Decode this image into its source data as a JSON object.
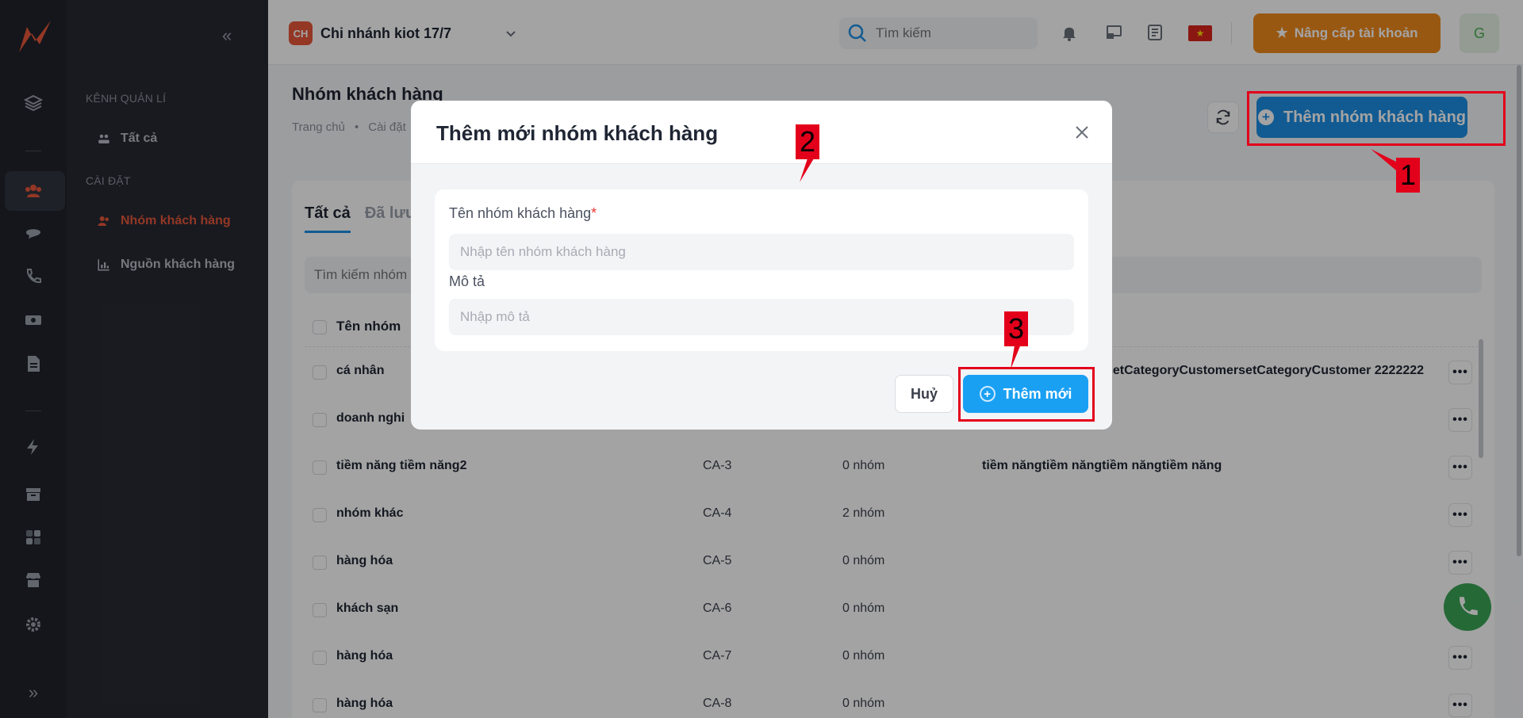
{
  "branch": {
    "badge": "CH",
    "name": "Chi nhánh kiot 17/7"
  },
  "search": {
    "placeholder": "Tìm kiếm"
  },
  "upgrade_label": "Nâng cấp tài khoản",
  "avatar_letter": "G",
  "sidebar": {
    "section_manage": "KÊNH QUẢN LÍ",
    "section_settings": "CÀI ĐẶT",
    "items": [
      {
        "label": "Tất cả"
      },
      {
        "label": "Nhóm khách hàng"
      },
      {
        "label": "Nguồn khách hàng"
      }
    ]
  },
  "page": {
    "title": "Nhóm khách hàng",
    "breadcrumb": [
      "Trang chủ",
      "•",
      "Cài đặt"
    ],
    "add_button": "Thêm nhóm khách hàng"
  },
  "tabs": [
    "Tất cả",
    "Đã lưu"
  ],
  "table": {
    "search_placeholder": "Tìm kiếm nhóm",
    "header_name": "Tên nhóm",
    "rows": [
      {
        "name": "cá nhân",
        "code": "",
        "count": "",
        "desc": "setCategoryCustomersetCategoryCustomer 2222222"
      },
      {
        "name": "doanh nghi",
        "code": "",
        "count": "",
        "desc": ""
      },
      {
        "name": "tiềm năng tiềm năng2",
        "code": "CA-3",
        "count": "0 nhóm",
        "desc": "tiềm năngtiềm năngtiềm năngtiềm năng"
      },
      {
        "name": "nhóm khác",
        "code": "CA-4",
        "count": "2 nhóm",
        "desc": ""
      },
      {
        "name": "hàng hóa",
        "code": "CA-5",
        "count": "0 nhóm",
        "desc": ""
      },
      {
        "name": "khách sạn",
        "code": "CA-6",
        "count": "0 nhóm",
        "desc": ""
      },
      {
        "name": "hàng hóa",
        "code": "CA-7",
        "count": "0 nhóm",
        "desc": ""
      },
      {
        "name": "hàng hóa",
        "code": "CA-8",
        "count": "0 nhóm",
        "desc": ""
      }
    ]
  },
  "dialog": {
    "title": "Thêm mới nhóm khách hàng",
    "name_label": "Tên nhóm khách hàng",
    "required_mark": "*",
    "name_placeholder": "Nhập tên nhóm khách hàng",
    "desc_label": "Mô tả",
    "desc_placeholder": "Nhập mô tả",
    "cancel": "Huỷ",
    "submit": "Thêm mới"
  },
  "annotations": {
    "n1": "1",
    "n2": "2",
    "n3": "3"
  },
  "colors": {
    "accent": "#1d8fe5",
    "brand": "#e8573a",
    "highlight": "#e3001b",
    "upgrade": "#f08a1d"
  }
}
